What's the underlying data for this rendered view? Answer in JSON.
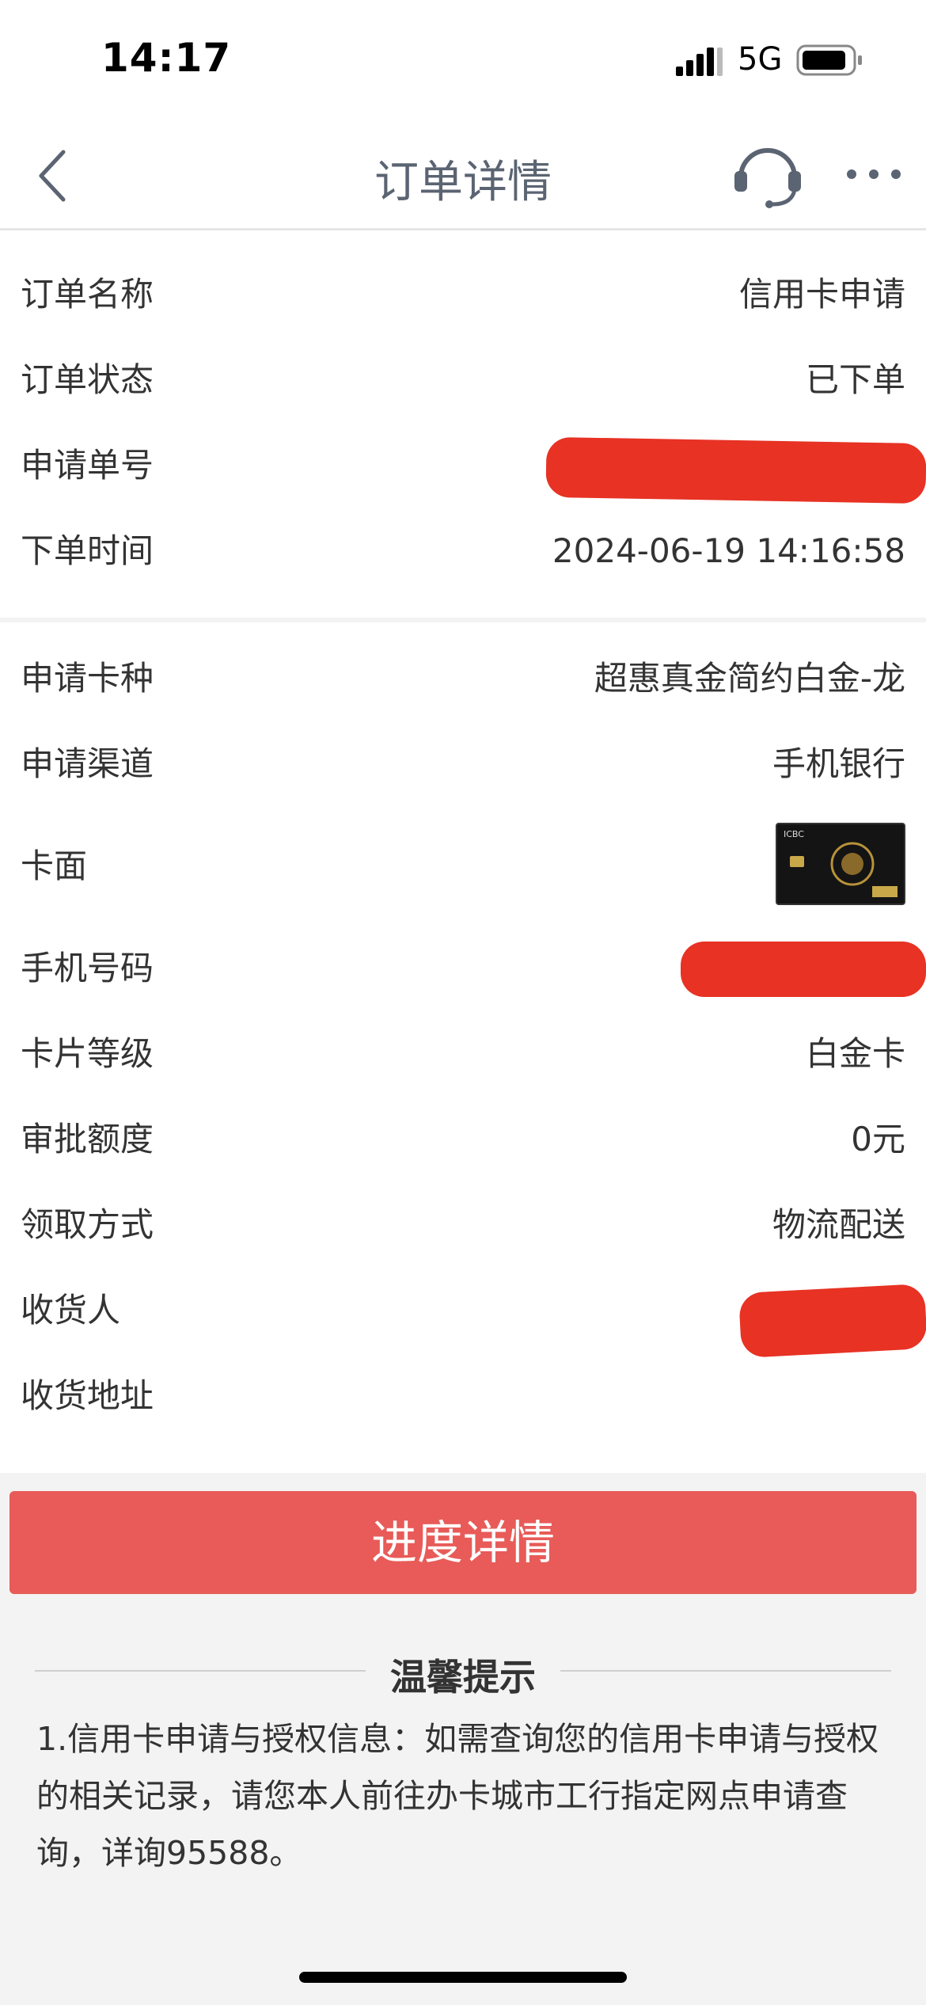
{
  "status_bar": {
    "time": "14:17",
    "network": "5G"
  },
  "nav": {
    "title": "订单详情",
    "icons": [
      "back-chevron-icon",
      "customer-service-icon",
      "more-icon"
    ]
  },
  "order_section": {
    "rows": [
      {
        "label": "订单名称",
        "value": "信用卡申请"
      },
      {
        "label": "订单状态",
        "value": "已下单"
      },
      {
        "label": "申请单号",
        "value": ""
      },
      {
        "label": "下单时间",
        "value": "2024-06-19 14:16:58"
      }
    ]
  },
  "card_section": {
    "rows": [
      {
        "label": "申请卡种",
        "value": "超惠真金简约白金-龙"
      },
      {
        "label": "申请渠道",
        "value": "手机银行"
      },
      {
        "label": "卡面",
        "value": ""
      },
      {
        "label": "手机号码",
        "value": ""
      },
      {
        "label": "卡片等级",
        "value": "白金卡"
      },
      {
        "label": "审批额度",
        "value": "0元"
      },
      {
        "label": "领取方式",
        "value": "物流配送"
      },
      {
        "label": "收货人",
        "value": ""
      },
      {
        "label": "收货地址",
        "value": ""
      }
    ],
    "card_image_text": "ICBC"
  },
  "progress_button": {
    "label": "进度详情"
  },
  "tips": {
    "title": "温馨提示",
    "body": "1.信用卡申请与授权信息：如需查询您的信用卡申请与授权的相关记录，请您本人前往办卡城市工行指定网点申请查询，详询95588。"
  },
  "colors": {
    "accent": "#e85b58",
    "redaction": "#e73224",
    "nav_title": "#5b6472"
  }
}
